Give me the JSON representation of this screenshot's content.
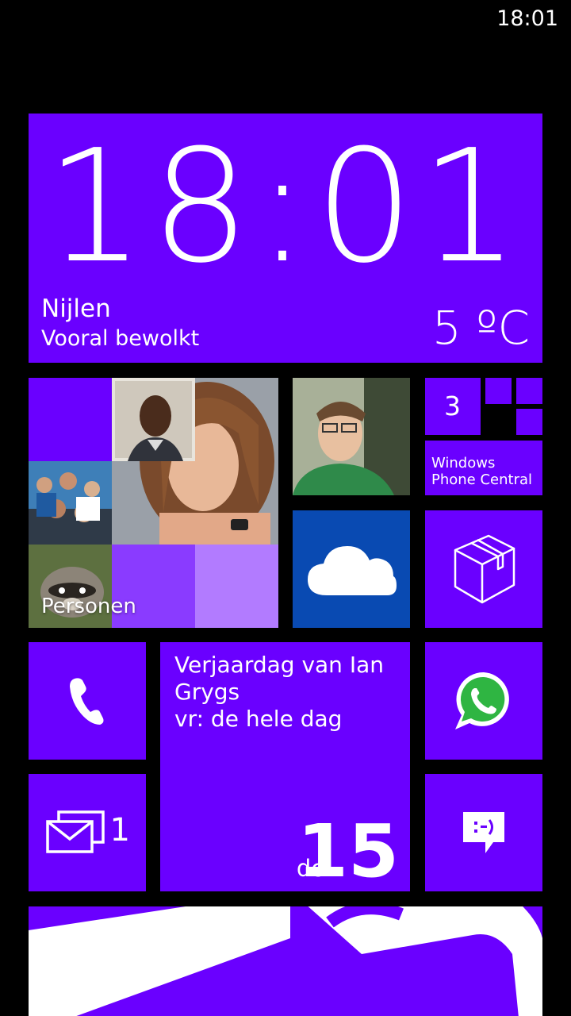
{
  "status_bar": {
    "time": "18:01"
  },
  "weather_tile": {
    "clock": "18:01",
    "city": "Nijlen",
    "condition": "Vooral bewolkt",
    "temperature": "5 ºC"
  },
  "people_tile": {
    "label": "Personen"
  },
  "wpc_tile": {
    "count": "3",
    "name_line1": "Windows",
    "name_line2": "Phone Central"
  },
  "calendar_tile": {
    "line1": "Verjaardag van Ian",
    "line2": "Grygs",
    "line3": "vr: de hele dag",
    "weekday": "do",
    "day": "15"
  },
  "mail_tile": {
    "count": "1"
  },
  "colors": {
    "accent": "#6a00ff",
    "onedrive": "#094ab2",
    "whatsapp": "#2fb542"
  },
  "icons": [
    "phone-icon",
    "mail-icon",
    "messaging-icon",
    "whatsapp-icon",
    "onedrive-cloud-icon",
    "package-icon"
  ]
}
